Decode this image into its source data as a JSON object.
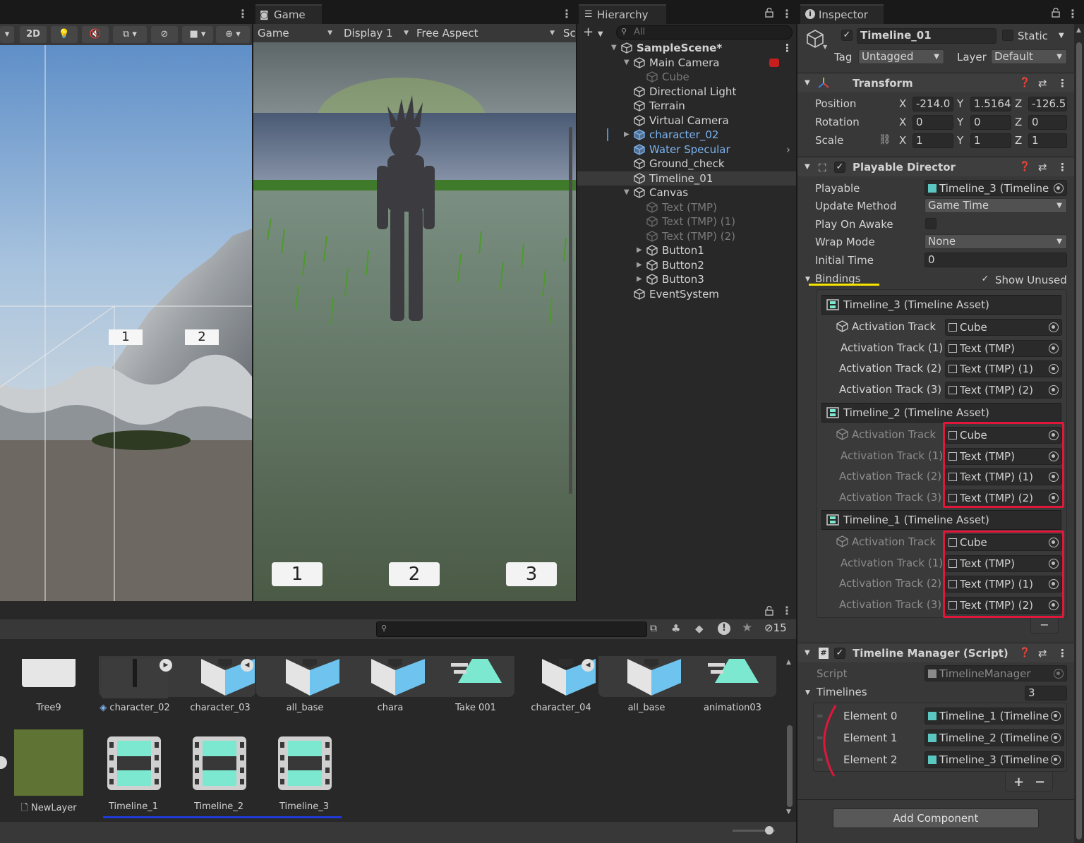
{
  "scene": {
    "toolbar": {
      "mode_2d": "2D"
    },
    "labels": [
      "1",
      "2"
    ]
  },
  "game": {
    "tab_label": "Game",
    "toolbar": {
      "game_dropdown": "Game",
      "display": "Display 1",
      "aspect": "Free Aspect",
      "scale_truncated": "Sc"
    },
    "buttons": [
      "1",
      "2",
      "3"
    ]
  },
  "hierarchy": {
    "tab_label": "Hierarchy",
    "search_placeholder": "All",
    "items": [
      {
        "label": "SampleScene*",
        "style": "scene"
      },
      {
        "label": "Main Camera",
        "style": "normal"
      },
      {
        "label": "Cube",
        "style": "dim"
      },
      {
        "label": "Directional Light",
        "style": "normal"
      },
      {
        "label": "Terrain",
        "style": "normal"
      },
      {
        "label": "Virtual Camera",
        "style": "normal"
      },
      {
        "label": "character_02",
        "style": "blue"
      },
      {
        "label": "Water Specular",
        "style": "blue"
      },
      {
        "label": "Ground_check",
        "style": "normal"
      },
      {
        "label": "Timeline_01",
        "style": "selected"
      },
      {
        "label": "Canvas",
        "style": "normal"
      },
      {
        "label": "Text (TMP)",
        "style": "dim"
      },
      {
        "label": "Text (TMP) (1)",
        "style": "dim"
      },
      {
        "label": "Text (TMP) (2)",
        "style": "dim"
      },
      {
        "label": "Button1",
        "style": "normal"
      },
      {
        "label": "Button2",
        "style": "normal"
      },
      {
        "label": "Button3",
        "style": "normal"
      },
      {
        "label": "EventSystem",
        "style": "normal"
      }
    ]
  },
  "project": {
    "hidden_count": "15",
    "assets_row1": [
      "Tree9",
      "character_02",
      "character_03",
      "all_base",
      "chara",
      "Take 001",
      "character_04",
      "all_base",
      "animation03"
    ],
    "assets_row2": [
      "NewLayer",
      "Timeline_1",
      "Timeline_2",
      "Timeline_3"
    ]
  },
  "inspector": {
    "tab_label": "Inspector",
    "object_name": "Timeline_01",
    "static_label": "Static",
    "tag_label": "Tag",
    "tag_value": "Untagged",
    "layer_label": "Layer",
    "layer_value": "Default",
    "transform": {
      "title": "Transform",
      "position_label": "Position",
      "rotation_label": "Rotation",
      "scale_label": "Scale",
      "axes": [
        "X",
        "Y",
        "Z"
      ],
      "position": [
        "-214.0",
        "1.5164",
        "-126.5"
      ],
      "rotation": [
        "0",
        "0",
        "0"
      ],
      "scale": [
        "1",
        "1",
        "1"
      ]
    },
    "playable_director": {
      "title": "Playable Director",
      "playable_label": "Playable",
      "playable_value": "Timeline_3 (Timeline",
      "update_method_label": "Update Method",
      "update_method_value": "Game Time",
      "play_on_awake_label": "Play On Awake",
      "wrap_mode_label": "Wrap Mode",
      "wrap_mode_value": "None",
      "initial_time_label": "Initial Time",
      "initial_time_value": "0",
      "bindings_label": "Bindings",
      "show_unused_label": "Show Unused",
      "timelines": [
        {
          "asset": "Timeline_3 (Timeline Asset)",
          "dim": false,
          "tracks": [
            {
              "name": "Activation Track",
              "binding": "Cube"
            },
            {
              "name": "Activation Track (1)",
              "binding": "Text (TMP)"
            },
            {
              "name": "Activation Track (2)",
              "binding": "Text (TMP) (1)"
            },
            {
              "name": "Activation Track (3)",
              "binding": "Text (TMP) (2)"
            }
          ]
        },
        {
          "asset": "Timeline_2 (Timeline Asset)",
          "dim": true,
          "tracks": [
            {
              "name": "Activation Track",
              "binding": "Cube"
            },
            {
              "name": "Activation Track (1)",
              "binding": "Text (TMP)"
            },
            {
              "name": "Activation Track (2)",
              "binding": "Text (TMP) (1)"
            },
            {
              "name": "Activation Track (3)",
              "binding": "Text (TMP) (2)"
            }
          ]
        },
        {
          "asset": "Timeline_1 (Timeline Asset)",
          "dim": true,
          "tracks": [
            {
              "name": "Activation Track",
              "binding": "Cube"
            },
            {
              "name": "Activation Track (1)",
              "binding": "Text (TMP)"
            },
            {
              "name": "Activation Track (2)",
              "binding": "Text (TMP) (1)"
            },
            {
              "name": "Activation Track (3)",
              "binding": "Text (TMP) (2)"
            }
          ]
        }
      ],
      "remove_label": "−"
    },
    "timeline_manager": {
      "title": "Timeline Manager (Script)",
      "script_label": "Script",
      "script_value": "TimelineManager",
      "timelines_label": "Timelines",
      "timelines_count": "3",
      "elements": [
        {
          "label": "Element 0",
          "value": "Timeline_1 (Timeline"
        },
        {
          "label": "Element 1",
          "value": "Timeline_2 (Timeline"
        },
        {
          "label": "Element 2",
          "value": "Timeline_3 (Timeline"
        }
      ],
      "add_label": "+",
      "remove_label": "−"
    },
    "add_component_label": "Add Component"
  },
  "colors": {
    "highlight_red": "#e0163a",
    "underline_yellow": "#f5e400",
    "underline_blue": "#1f3ad8",
    "link_blue": "#7cb4f0",
    "asset_cyan": "#7de8d0"
  }
}
